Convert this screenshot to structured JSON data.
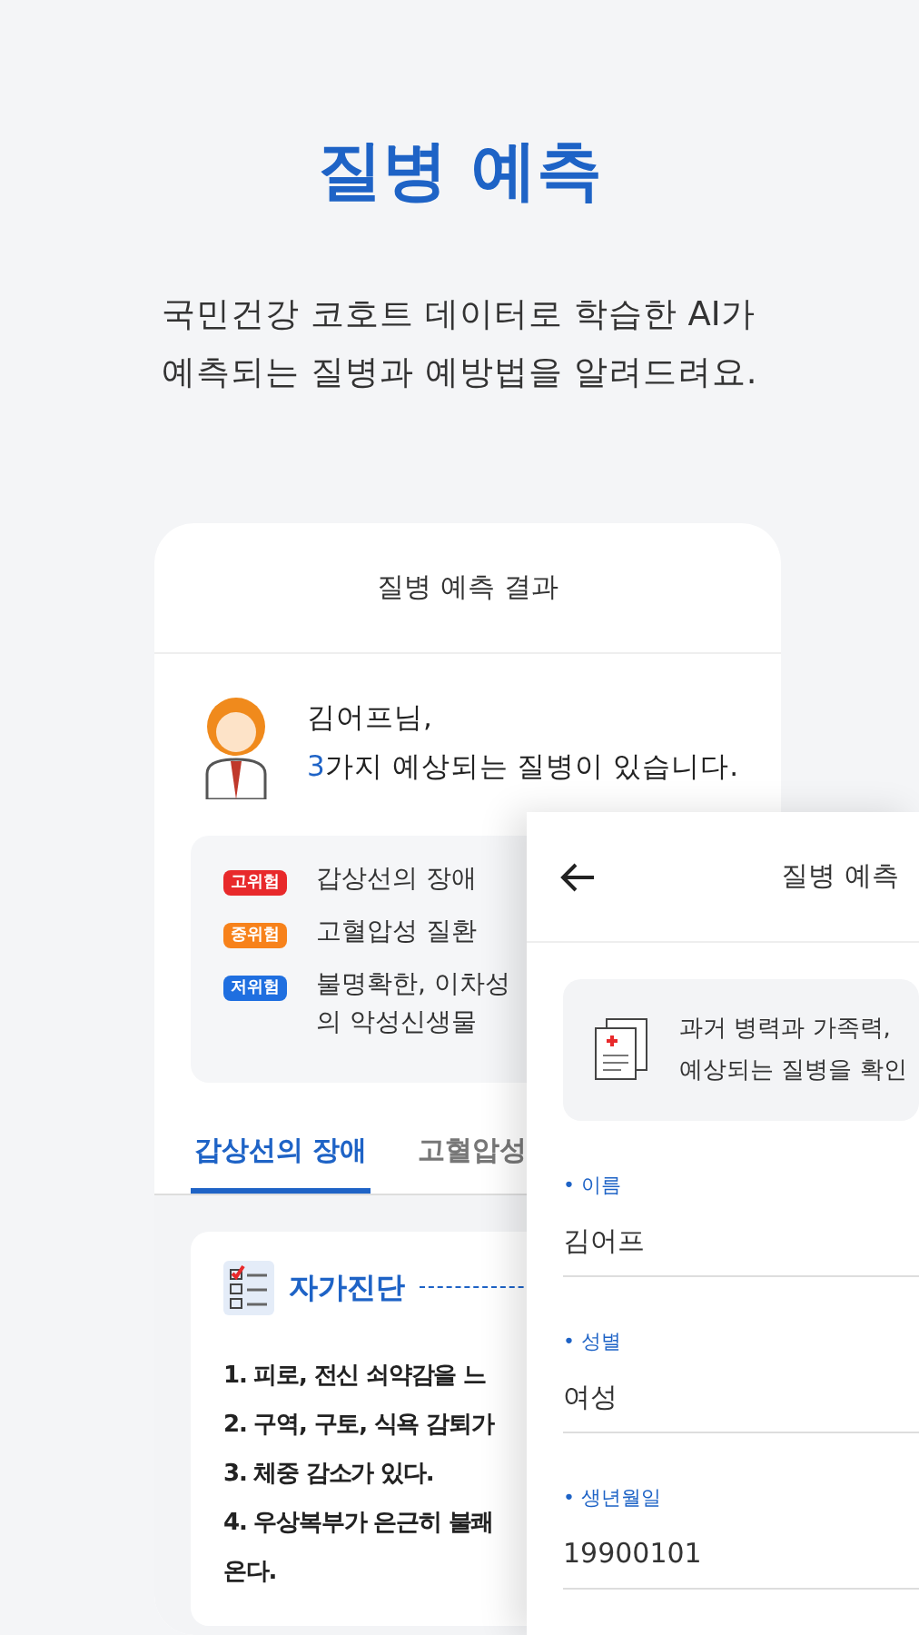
{
  "headline": "질병 예측",
  "subtitle_lines": [
    "국민건강 코호트 데이터로 학습한 AI가",
    "예측되는 질병과 예방법을 알려드려요."
  ],
  "result_screen": {
    "title": "질병 예측 결과",
    "greeting": "김어프님,",
    "count": "3",
    "summary": "가지 예상되는 질병이 있습니다.",
    "risks": [
      {
        "badge": "고위험",
        "color": "#e8292b",
        "lines": [
          "갑상선의 장애"
        ]
      },
      {
        "badge": "중위험",
        "color": "#f7821b",
        "lines": [
          "고혈압성 질환"
        ]
      },
      {
        "badge": "저위험",
        "color": "#1f6fe0",
        "lines": [
          "불명확한, 이차성",
          "의 악성신생물"
        ]
      }
    ],
    "tabs": [
      {
        "label": "갑상선의 장애",
        "selected": true
      },
      {
        "label": "고혈압성",
        "selected": false
      }
    ],
    "section_title": "자가진단",
    "checklist": [
      {
        "lines": [
          "1. 피로, 전신 쇠약감을 느"
        ]
      },
      {
        "lines": [
          "2. 구역, 구토, 식욕 감퇴가"
        ]
      },
      {
        "lines": [
          "3. 체중 감소가 있다."
        ]
      },
      {
        "lines": [
          "4. 우상복부가 은근히 불쾌",
          "온다."
        ]
      }
    ]
  },
  "input_screen": {
    "title": "질병 예측",
    "info_lines": [
      "과거 병력과 가족력,",
      "예상되는 질병을 확인"
    ],
    "fields": [
      {
        "label": "• 이름",
        "value": "김어프"
      },
      {
        "label": "• 성별",
        "value": "여성"
      },
      {
        "label": "• 생년월일",
        "value": "19900101"
      }
    ]
  }
}
